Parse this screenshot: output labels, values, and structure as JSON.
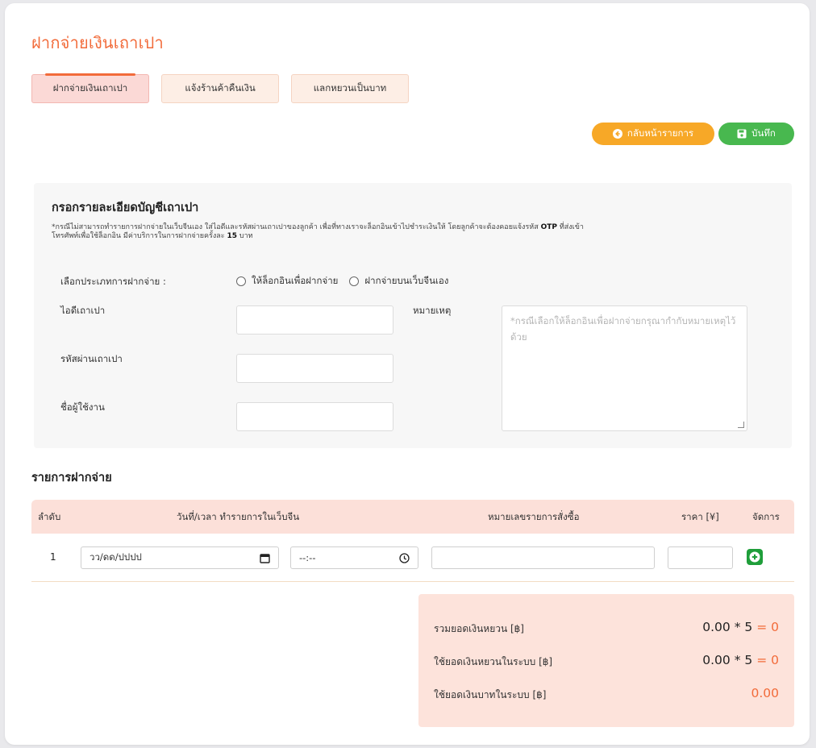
{
  "page": {
    "title": "ฝากจ่ายเงินเถาเปา"
  },
  "tabs": [
    {
      "label": "ฝากจ่ายเงินเถาเปา",
      "active": true
    },
    {
      "label": "แจ้งร้านค้าคืนเงิน",
      "active": false
    },
    {
      "label": "แลกหยวนเป็นบาท",
      "active": false
    }
  ],
  "actions": {
    "back_label": "กลับหน้ารายการ",
    "save_label": "บันทึก"
  },
  "form": {
    "title": "กรอกรายละเอียดบัญชีเถาเปา",
    "note_line1_a": "*กรณีไม่สามารถทำรายการฝากจ่ายในเว็บจีนเอง ใส่ไอดีและรหัสผ่านเถาเปาของลูกค้า เพื่อที่ทางเราจะล็อกอินเข้าไปชำระเงินให้ โดยลูกค้าจะต้องคอยแจ้งรหัส ",
    "note_otp": "OTP",
    "note_line1_b": " ที่ส่งเข้า",
    "note_line2_a": "โทรศัพท์เพื่อใช้ล็อกอิน มีค่าบริการในการฝากจ่ายครั้งละ ",
    "note_fee": "15",
    "note_line2_b": " บาท",
    "payment_type_label": "เลือกประเภทการฝากจ่าย :",
    "payment_options": [
      "ให้ล็อกอินเพื่อฝากจ่าย",
      "ฝากจ่ายบนเว็บจีนเอง"
    ],
    "taobao_id_label": "ไอดีเถาเปา",
    "taobao_password_label": "รหัสผ่านเถาเปา",
    "username_label": "ชื่อผู้ใช้งาน",
    "remark_label": "หมายเหตุ",
    "remark_placeholder": "*กรณีเลือกให้ล็อกอินเพื่อฝากจ่ายกรุณากำกับหมายเหตุไว้ด้วย",
    "taobao_id_value": "",
    "taobao_password_value": "",
    "username_value": ""
  },
  "items": {
    "title": "รายการฝากจ่าย",
    "columns": [
      "ลำดับ",
      "วันที่/เวลา ทำรายการในเว็บจีน",
      "หมายเลขรายการสั่งซื้อ",
      "ราคา [¥]",
      "จัดการ"
    ],
    "rows": [
      {
        "index": "1",
        "date_placeholder": "วว/ดด/ปปปป",
        "time_placeholder": "--:--",
        "order_no": "",
        "price": ""
      }
    ]
  },
  "summary": {
    "total_yuan_label": "รวมยอดเงินหยวน [฿]",
    "total_yuan_amount": "0.00 * 5",
    "total_yuan_eq": "=",
    "total_yuan_result": "0",
    "used_yuan_label": "ใช้ยอดเงินหยวนในระบบ [฿]",
    "used_yuan_amount": "0.00 * 5",
    "used_yuan_eq": "=",
    "used_yuan_result": "0",
    "used_baht_label": "ใช้ยอดเงินบาทในระบบ [฿]",
    "used_baht_value": "0.00"
  },
  "colors": {
    "accent": "#f26b3a",
    "back_button": "#f7a827",
    "save_button": "#48b84f",
    "add_button": "#1f9e3a"
  },
  "icons": {
    "back": "arrow-left-circle-icon",
    "save": "floppy-disk-icon",
    "calendar": "calendar-icon",
    "clock": "clock-icon",
    "add": "plus-circle-icon"
  }
}
